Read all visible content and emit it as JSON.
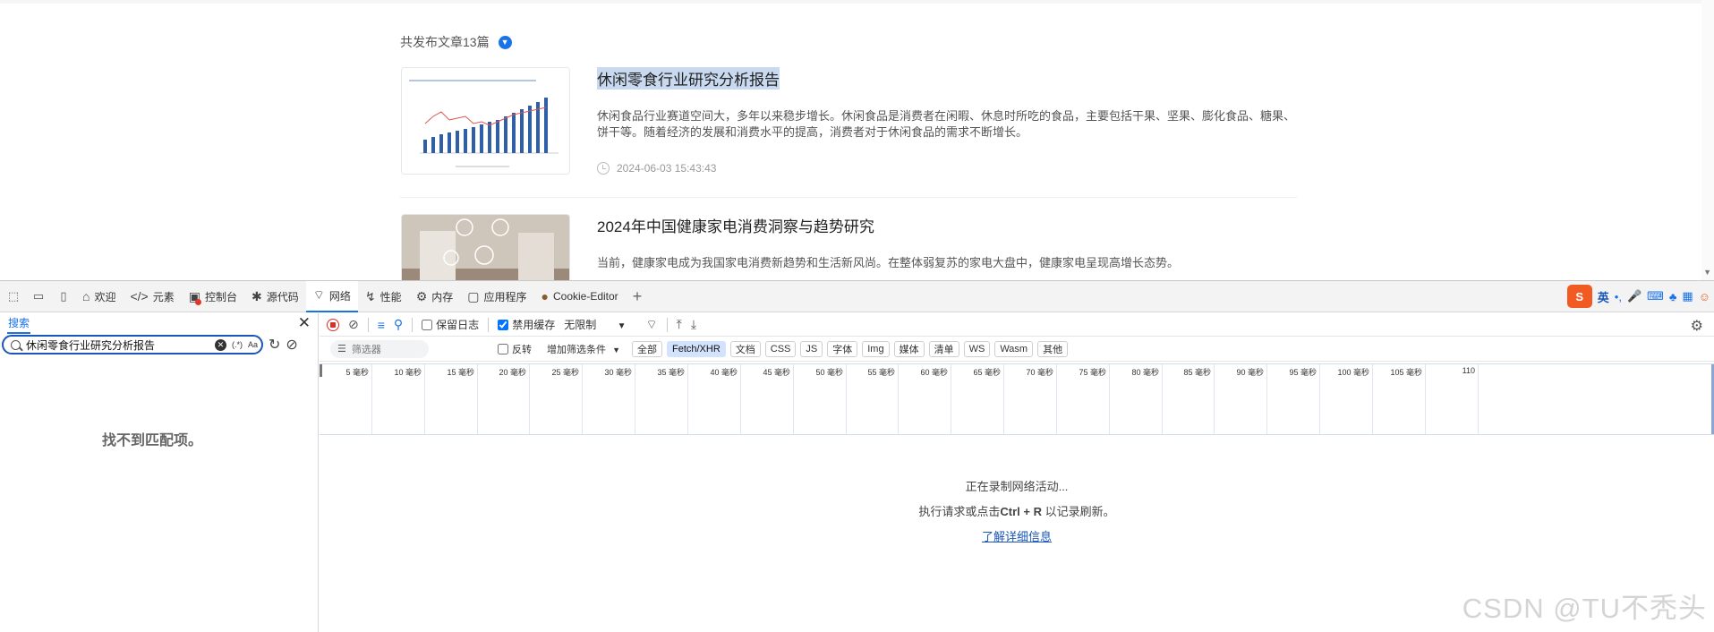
{
  "page": {
    "article_count": "共发布文章13篇",
    "articles": [
      {
        "title": "休闲零食行业研究分析报告",
        "summary": "休闲食品行业赛道空间大，多年以来稳步增长。休闲食品是消费者在闲暇、休息时所吃的食品，主要包括干果、坚果、膨化食品、糖果、饼干等。随着经济的发展和消费水平的提高，消费者对于休闲食品的需求不断增长。",
        "date": "2024-06-03 15:43:43"
      },
      {
        "title": "2024年中国健康家电消费洞察与趋势研究",
        "summary": "当前，健康家电成为我国家电消费新趋势和生活新风尚。在整体弱复苏的家电大盘中，健康家电呈现高增长态势。"
      }
    ]
  },
  "devtools": {
    "tabs": [
      {
        "label": "欢迎",
        "icon": "home-icon"
      },
      {
        "label": "元素",
        "icon": "code-icon"
      },
      {
        "label": "控制台",
        "icon": "console-icon"
      },
      {
        "label": "源代码",
        "icon": "bug-icon"
      },
      {
        "label": "网络",
        "icon": "wifi-icon"
      },
      {
        "label": "性能",
        "icon": "performance-icon"
      },
      {
        "label": "内存",
        "icon": "memory-icon"
      },
      {
        "label": "应用程序",
        "icon": "application-icon"
      },
      {
        "label": "Cookie-Editor",
        "icon": "cookie-icon"
      }
    ],
    "ime": {
      "lang": "英"
    },
    "search": {
      "title": "搜索",
      "query": "休闲零食行业研究分析报告",
      "regex_label": "(.*)",
      "case_label": "Aa",
      "no_match": "找不到匹配项。"
    },
    "network": {
      "preserve_log": "保留日志",
      "disable_cache": "禁用缓存",
      "throttle": "无限制",
      "filter_placeholder": "筛选器",
      "invert": "反转",
      "more_filters": "增加筛选条件",
      "type_filters": [
        "全部",
        "Fetch/XHR",
        "文档",
        "CSS",
        "JS",
        "字体",
        "Img",
        "媒体",
        "清单",
        "WS",
        "Wasm",
        "其他"
      ],
      "active_filter": "Fetch/XHR",
      "timeline_ticks": [
        "5 毫秒",
        "10 毫秒",
        "15 毫秒",
        "20 毫秒",
        "25 毫秒",
        "30 毫秒",
        "35 毫秒",
        "40 毫秒",
        "45 毫秒",
        "50 毫秒",
        "55 毫秒",
        "60 毫秒",
        "65 毫秒",
        "70 毫秒",
        "75 毫秒",
        "80 毫秒",
        "85 毫秒",
        "90 毫秒",
        "95 毫秒",
        "100 毫秒",
        "105 毫秒",
        "110"
      ],
      "recording": "正在录制网络活动...",
      "hint_prefix": "执行请求或点击",
      "hint_key": "Ctrl + R",
      "hint_suffix": "以记录刷新。",
      "learn_more": "了解详细信息"
    }
  },
  "watermark": "CSDN @TU不秃头",
  "colors": {
    "accent": "#1a73e8",
    "record": "#d93025",
    "ime": "#f25a24"
  }
}
